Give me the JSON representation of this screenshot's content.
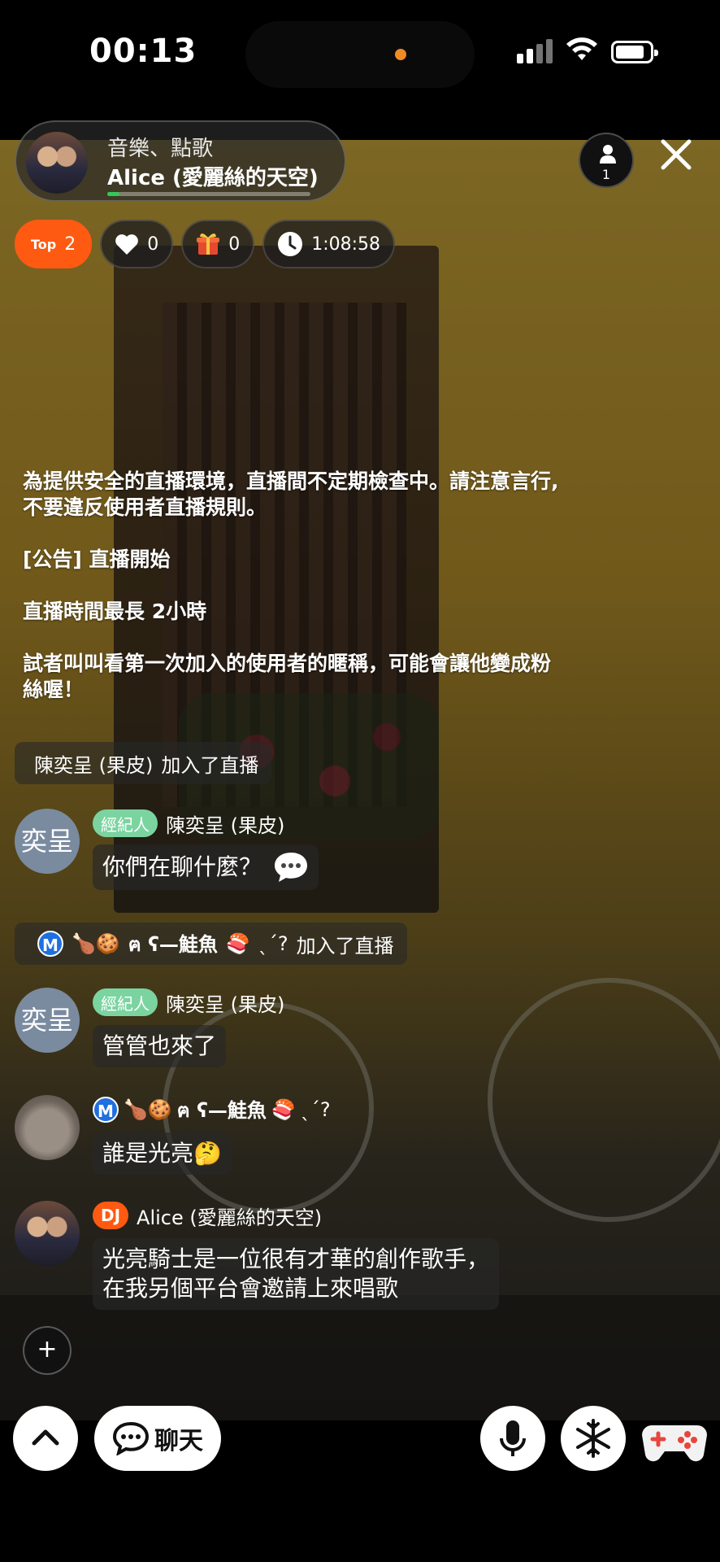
{
  "status_bar": {
    "time": "00:13"
  },
  "host": {
    "category": "音樂、點歌",
    "name": "Alice (愛麗絲的天空)",
    "progress": 0.06
  },
  "viewers": {
    "count": "1"
  },
  "stats": {
    "top_label": "Top",
    "top_rank": "2",
    "likes": "0",
    "gifts": "0",
    "duration": "1:08:58"
  },
  "announcement": {
    "rules": "為提供安全的直播環境，直播間不定期檢查中。請注意言行,不要違反使用者直播規則。",
    "notice": "[公告] 直播開始",
    "max_time": "直播時間最長  2小時",
    "tip": "試者叫叫看第一次加入的使用者的暱稱，可能會讓他變成粉絲喔！"
  },
  "chat": {
    "join1": {
      "user": "陳奕呈 (果皮)",
      "action": "加入了直播"
    },
    "msg1": {
      "avatar_text": "奕呈",
      "badge": "經紀人",
      "user": "陳奕呈 (果皮)",
      "text": "你們在聊什麼？"
    },
    "join2": {
      "user_emoji": "🍗🍪",
      "user_text": "ฅ ʕ—鮭魚",
      "user_emoji2": "🍣",
      "user_tail": "ˎˊ?",
      "action": "加入了直播"
    },
    "msg2": {
      "avatar_text": "奕呈",
      "badge": "經紀人",
      "user": "陳奕呈 (果皮)",
      "text": "管管也來了"
    },
    "msg3": {
      "user_emoji": "🍗🍪",
      "user_text": "ฅ ʕ—鮭魚",
      "user_emoji2": "🍣",
      "user_tail": "ˎˊ?",
      "text": "誰是光亮",
      "text_emoji": "🤔"
    },
    "msg4": {
      "badge": "DJ",
      "user": "Alice (愛麗絲的天空)",
      "line1": "光亮騎士是一位很有才華的創作歌手，",
      "line2": "在我另個平台會邀請上來唱歌"
    },
    "m_badge": "M"
  },
  "controls": {
    "chat_label": "聊天",
    "plus": "+"
  },
  "icons": [
    "person-icon",
    "close-icon",
    "heart-icon",
    "gift-icon",
    "clock-icon",
    "chat-bubble-icon",
    "chevron-up-icon",
    "microphone-icon",
    "snowflake-icon",
    "gamepad-icon"
  ],
  "colors": {
    "accent_orange": "#ff5a12",
    "agent_green": "#7bd4a0",
    "m_blue": "#1f6fe0"
  }
}
